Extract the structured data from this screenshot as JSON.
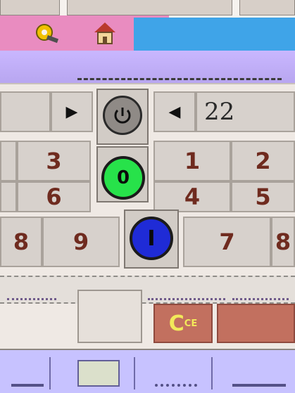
{
  "header": {
    "settings_icon": "gear-wrench-icon",
    "home_icon": "home-icon"
  },
  "readout": {
    "value": "22"
  },
  "keypad": {
    "digits": {
      "k1": "1",
      "k2": "2",
      "k3": "3",
      "k4": "4",
      "k5": "5",
      "k6": "6",
      "k7": "7",
      "k8": "8",
      "k9": "9",
      "k0": "0"
    },
    "left_arrow": "▶",
    "right_arrow": "◀"
  },
  "controls": {
    "power_icon": "power-icon",
    "start_label": "0",
    "stop_label": "I",
    "clear_label_main": "C",
    "clear_label_sub": "CE"
  },
  "colors": {
    "pink": "#e98cc0",
    "blue": "#3fa4e8",
    "lavender": "#c9b7ff",
    "green": "#27e24a",
    "deep_blue": "#1f2bd6",
    "clear_red": "#c2705f"
  }
}
